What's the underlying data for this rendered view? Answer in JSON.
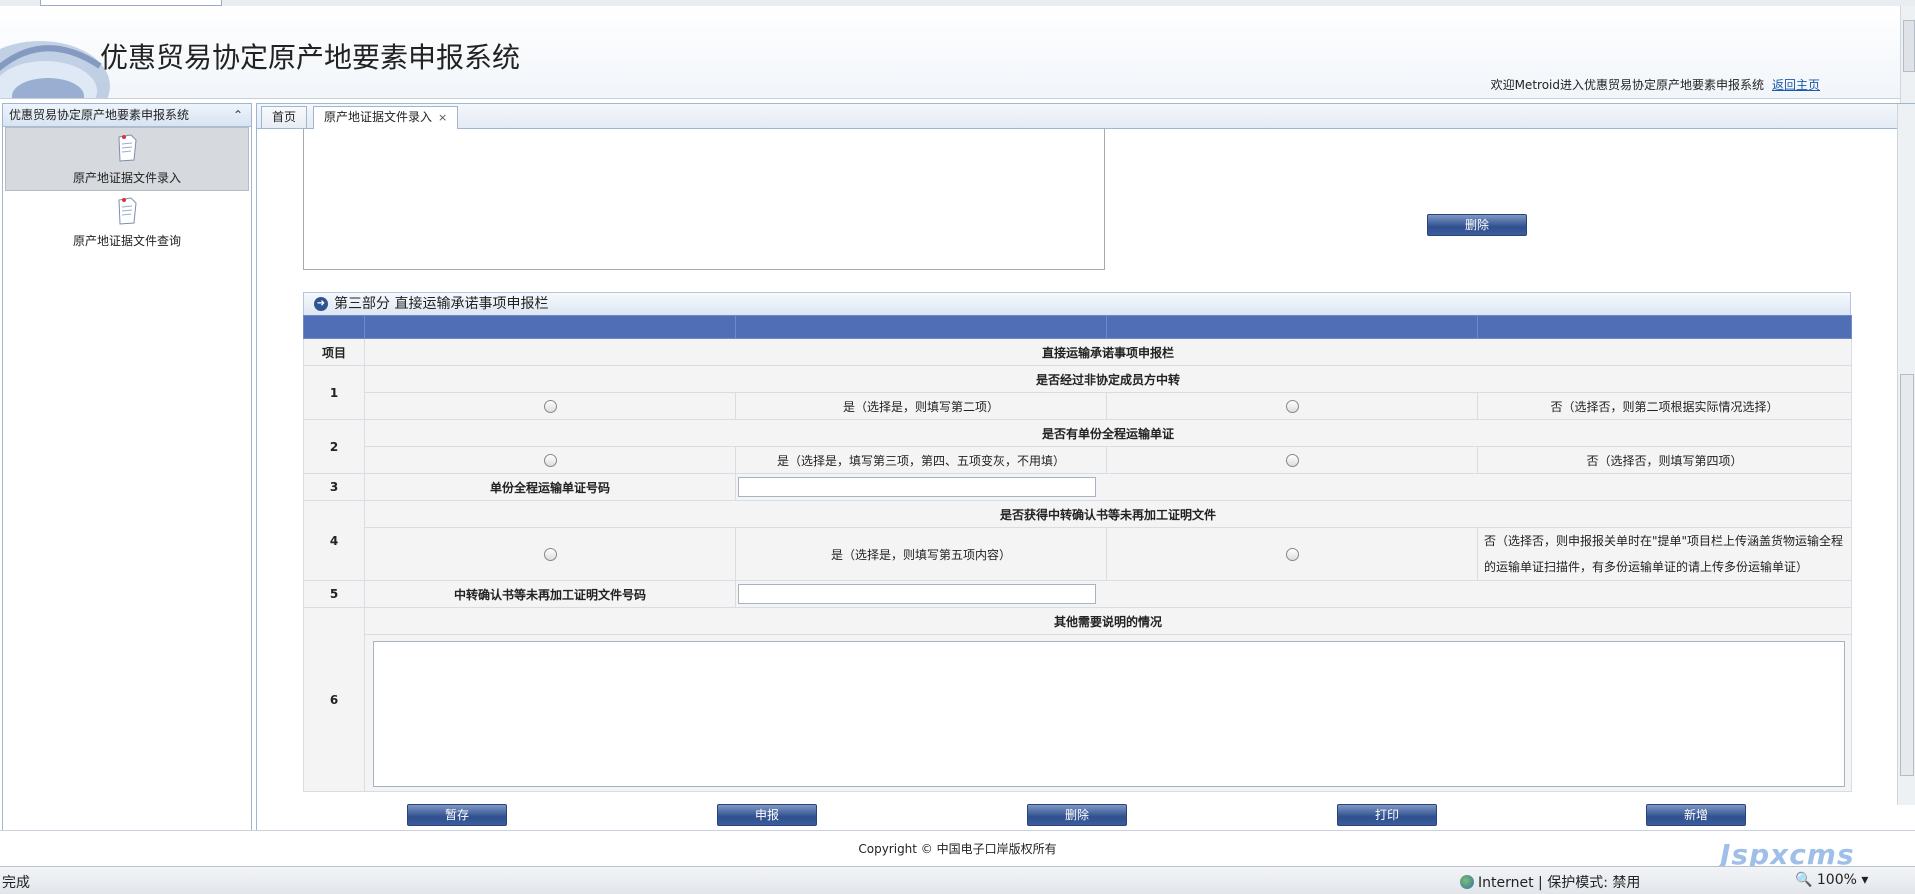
{
  "app": {
    "title": "优惠贸易协定原产地要素申报系统",
    "welcome": "欢迎Metroid进入优惠贸易协定原产地要素申报系统",
    "home_link": "返回主页"
  },
  "sidebar": {
    "header": "优惠贸易协定原产地要素申报系统",
    "collapse_icon": "⌃",
    "items": [
      {
        "label": "原产地证据文件录入"
      },
      {
        "label": "原产地证据文件查询"
      }
    ]
  },
  "tabs": [
    {
      "label": "首页"
    },
    {
      "label": "原产地证据文件录入",
      "close": "×"
    }
  ],
  "upper": {
    "delete_label": "删除"
  },
  "section3": {
    "title": "第三部分 直接运输承诺事项申报栏",
    "col_item": "项目",
    "col_main": "直接运输承诺事项申报栏",
    "rows": {
      "r1": {
        "num": "1",
        "question": "是否经过非协定成员方中转",
        "yes": "是（选择是，则填写第二项）",
        "no": "否（选择否，则第二项根据实际情况选择）"
      },
      "r2": {
        "num": "2",
        "question": "是否有单份全程运输单证",
        "yes": "是（选择是，填写第三项，第四、五项变灰，不用填）",
        "no": "否（选择否，则填写第四项）"
      },
      "r3": {
        "num": "3",
        "label": "单份全程运输单证号码",
        "value": ""
      },
      "r4": {
        "num": "4",
        "question": "是否获得中转确认书等未再加工证明文件",
        "yes": "是（选择是，则填写第五项内容）",
        "no": "否（选择否，则申报报关单时在\"提单\"项目栏上传涵盖货物运输全程的运输单证扫描件，有多份运输单证的请上传多份运输单证）"
      },
      "r5": {
        "num": "5",
        "label": "中转确认书等未再加工证明文件号码",
        "value": ""
      },
      "r6": {
        "num": "6",
        "label": "其他需要说明的情况",
        "value": ""
      }
    }
  },
  "actions": {
    "save": "暂存",
    "submit": "申报",
    "delete": "删除",
    "print": "打印",
    "add": "新增"
  },
  "footer": {
    "copyright": "Copyright © 中国电子口岸版权所有"
  },
  "statusbar": {
    "left": "完成",
    "zone": "Internet | 保护模式: 禁用",
    "zoom": "100%"
  },
  "watermark": "Jspxcms"
}
